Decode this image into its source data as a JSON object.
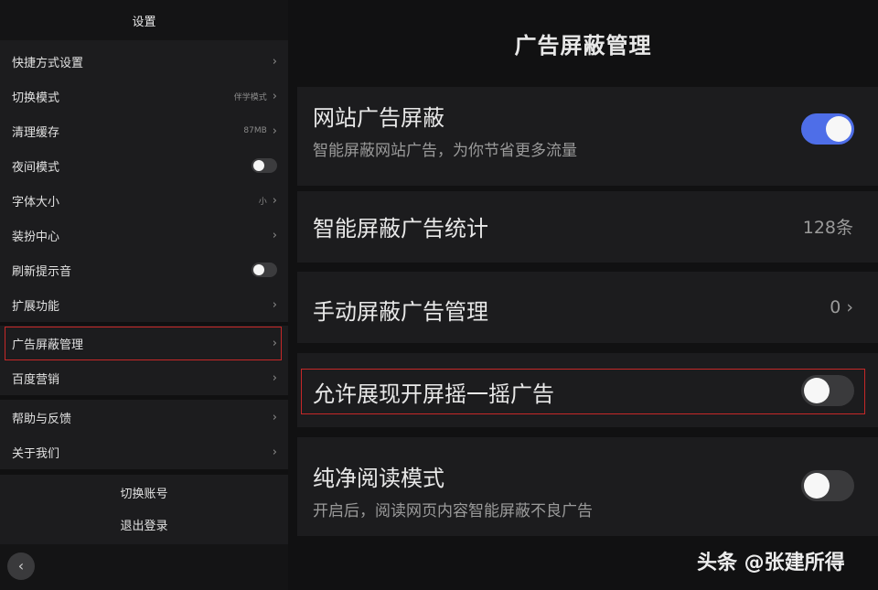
{
  "left_panel": {
    "title": "设置",
    "items": [
      {
        "label": "快捷方式设置",
        "value": "",
        "control": "chevron"
      },
      {
        "label": "切换模式",
        "value": "伴学模式",
        "control": "chevron"
      },
      {
        "label": "清理缓存",
        "value": "87MB",
        "control": "chevron"
      },
      {
        "label": "夜间模式",
        "value": "",
        "control": "toggle",
        "on": false
      },
      {
        "label": "字体大小",
        "value": "小",
        "control": "chevron"
      },
      {
        "label": "装扮中心",
        "value": "",
        "control": "chevron"
      },
      {
        "label": "刷新提示音",
        "value": "",
        "control": "toggle",
        "on": false
      },
      {
        "label": "扩展功能",
        "value": "",
        "control": "chevron"
      },
      {
        "label": "广告屏蔽管理",
        "value": "",
        "control": "chevron",
        "selected": true
      },
      {
        "label": "百度营销",
        "value": "",
        "control": "chevron"
      },
      {
        "label": "帮助与反馈",
        "value": "",
        "control": "chevron"
      },
      {
        "label": "关于我们",
        "value": "",
        "control": "chevron"
      }
    ],
    "switch_account": "切换账号",
    "logout": "退出登录",
    "back_icon": "chevron-left-icon"
  },
  "right_panel": {
    "title": "广告屏蔽管理",
    "rows": [
      {
        "title": "网站广告屏蔽",
        "subtitle": "智能屏蔽网站广告，为你节省更多流量",
        "control": "toggle",
        "on": true
      },
      {
        "title": "智能屏蔽广告统计",
        "value": "128条",
        "control": "value"
      },
      {
        "title": "手动屏蔽广告管理",
        "value": "0",
        "control": "chevron"
      },
      {
        "title": "允许展现开屏摇一摇广告",
        "control": "toggle",
        "on": false,
        "highlighted": true
      },
      {
        "title": "纯净阅读模式",
        "subtitle": "开启后，阅读网页内容智能屏蔽不良广告",
        "control": "toggle",
        "on": false
      }
    ]
  },
  "colors": {
    "toggle_on": "#4e6ee8",
    "highlight_border": "#c62828"
  },
  "watermark": "头条 @张建所得"
}
